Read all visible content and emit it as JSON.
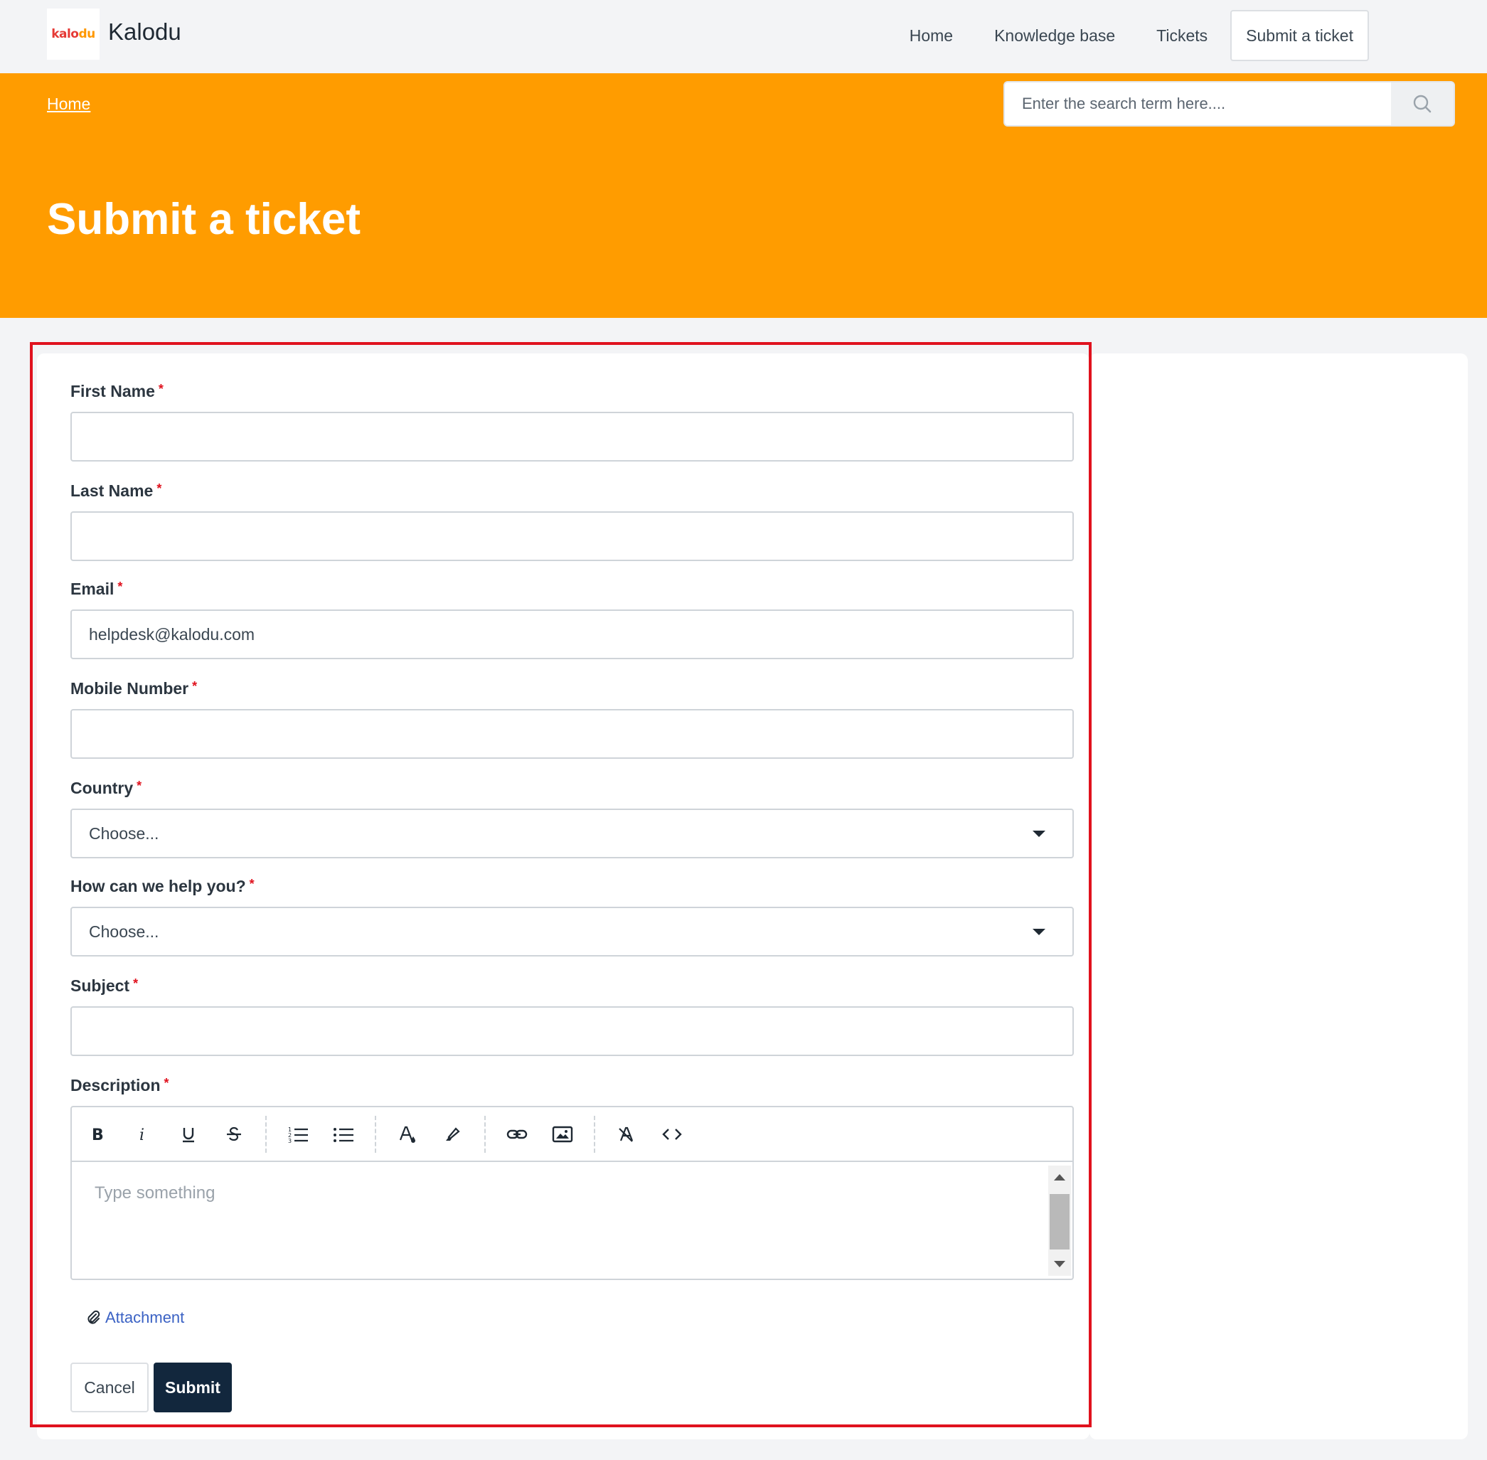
{
  "brand": {
    "logo_text_main": "kalo",
    "logo_text_accent": "du",
    "name": "Kalodu"
  },
  "nav": {
    "items": [
      {
        "label": "Home"
      },
      {
        "label": "Knowledge base"
      },
      {
        "label": "Tickets"
      },
      {
        "label": "Submit a ticket",
        "active": true
      }
    ]
  },
  "breadcrumb": {
    "home": "Home"
  },
  "search": {
    "placeholder": "Enter the search term here...."
  },
  "page_title": "Submit a ticket",
  "form": {
    "first_name": {
      "label": "First Name",
      "value": ""
    },
    "last_name": {
      "label": "Last Name",
      "value": ""
    },
    "email": {
      "label": "Email",
      "value": "helpdesk@kalodu.com"
    },
    "mobile": {
      "label": "Mobile Number",
      "value": ""
    },
    "country": {
      "label": "Country",
      "selected": "Choose..."
    },
    "help": {
      "label": "How can we help you?",
      "selected": "Choose..."
    },
    "subject": {
      "label": "Subject",
      "value": ""
    },
    "description": {
      "label": "Description",
      "placeholder": "Type something"
    },
    "required_marker": "*",
    "attachment": "Attachment",
    "cancel": "Cancel",
    "submit": "Submit"
  },
  "colors": {
    "hero": "#ff9c00",
    "submit_button": "#12273d",
    "highlight": "#e0121e",
    "link": "#3b62c4"
  },
  "toolbar_icons": [
    "bold-icon",
    "italic-icon",
    "underline-icon",
    "strikethrough-icon",
    "ordered-list-icon",
    "bullet-list-icon",
    "text-color-icon",
    "highlight-icon",
    "link-icon",
    "image-icon",
    "clear-format-icon",
    "code-icon"
  ]
}
